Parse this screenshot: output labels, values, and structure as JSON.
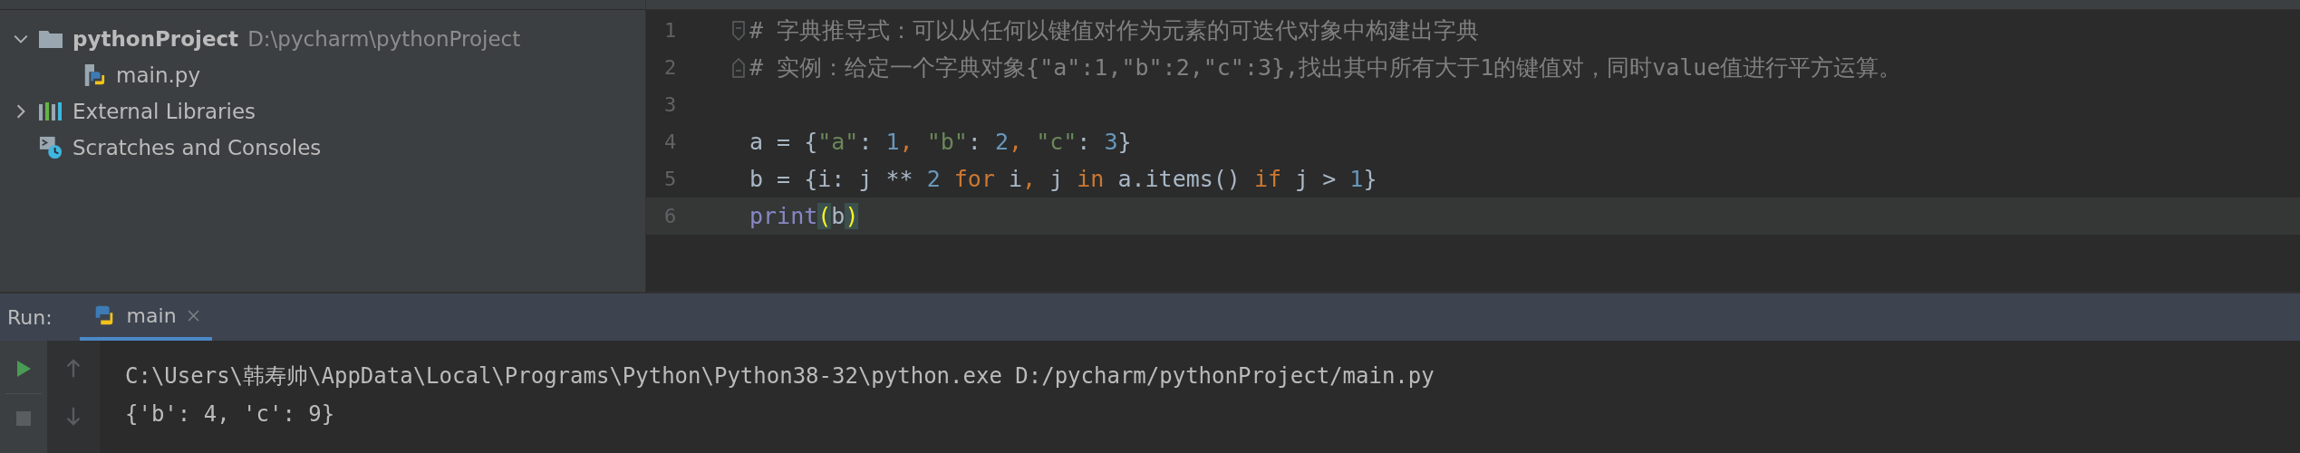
{
  "project_tree": [
    {
      "label": "pythonProject",
      "path": "D:\\pycharm\\pythonProject",
      "kind": "folder",
      "expanded": true,
      "children": [
        {
          "label": "main.py",
          "kind": "python-file"
        }
      ]
    },
    {
      "label": "External Libraries",
      "kind": "libraries",
      "expanded": false
    },
    {
      "label": "Scratches and Consoles",
      "kind": "scratches"
    }
  ],
  "editor": {
    "lines": [
      {
        "number": "1",
        "fold_marker": true,
        "current": false,
        "tokens": [
          {
            "kind": "comment",
            "text": "# 字典推导式：可以从任何以键值对作为元素的可迭代对象中构建出字典"
          }
        ]
      },
      {
        "number": "2",
        "fold_marker": true,
        "current": false,
        "tokens": [
          {
            "kind": "comment",
            "text": "# 实例：给定一个字典对象{\"a\":1,\"b\":2,\"c\":3},找出其中所有大于1的键值对，同时value值进行平方运算。"
          }
        ]
      },
      {
        "number": "3",
        "current": false
      },
      {
        "number": "4",
        "current": false,
        "tokens": [
          {
            "kind": "plain",
            "text": "a = {"
          },
          {
            "kind": "string",
            "text": "\"a\""
          },
          {
            "kind": "plain",
            "text": ": "
          },
          {
            "kind": "number",
            "text": "1"
          },
          {
            "kind": "keyword",
            "text": ", "
          },
          {
            "kind": "string",
            "text": "\"b\""
          },
          {
            "kind": "plain",
            "text": ": "
          },
          {
            "kind": "number",
            "text": "2"
          },
          {
            "kind": "keyword",
            "text": ", "
          },
          {
            "kind": "string",
            "text": "\"c\""
          },
          {
            "kind": "plain",
            "text": ": "
          },
          {
            "kind": "number",
            "text": "3"
          },
          {
            "kind": "plain",
            "text": "}"
          }
        ]
      },
      {
        "number": "5",
        "current": false,
        "tokens": [
          {
            "kind": "plain",
            "text": "b = {i: j ** "
          },
          {
            "kind": "number",
            "text": "2"
          },
          {
            "kind": "keyword",
            "text": " for "
          },
          {
            "kind": "plain",
            "text": "i"
          },
          {
            "kind": "keyword",
            "text": ", "
          },
          {
            "kind": "plain",
            "text": "j "
          },
          {
            "kind": "keyword",
            "text": "in "
          },
          {
            "kind": "plain",
            "text": "a.items() "
          },
          {
            "kind": "keyword",
            "text": "if "
          },
          {
            "kind": "plain",
            "text": "j > "
          },
          {
            "kind": "number",
            "text": "1"
          },
          {
            "kind": "plain",
            "text": "}"
          }
        ]
      },
      {
        "number": "6",
        "current": true,
        "tokens": [
          {
            "kind": "builtin",
            "text": "print"
          },
          {
            "kind": "brace-match",
            "text": "("
          },
          {
            "kind": "plain",
            "text": "b"
          },
          {
            "kind": "brace-match",
            "text": ")"
          }
        ]
      }
    ]
  },
  "run_panel": {
    "label": "Run:",
    "tabs": [
      {
        "label": "main",
        "selected": true
      }
    ],
    "output": [
      "C:\\Users\\韩寿帅\\AppData\\Local\\Programs\\Python\\Python38-32\\python.exe D:/pycharm/pythonProject/main.py",
      "{'b': 4, 'c': 9}"
    ]
  }
}
